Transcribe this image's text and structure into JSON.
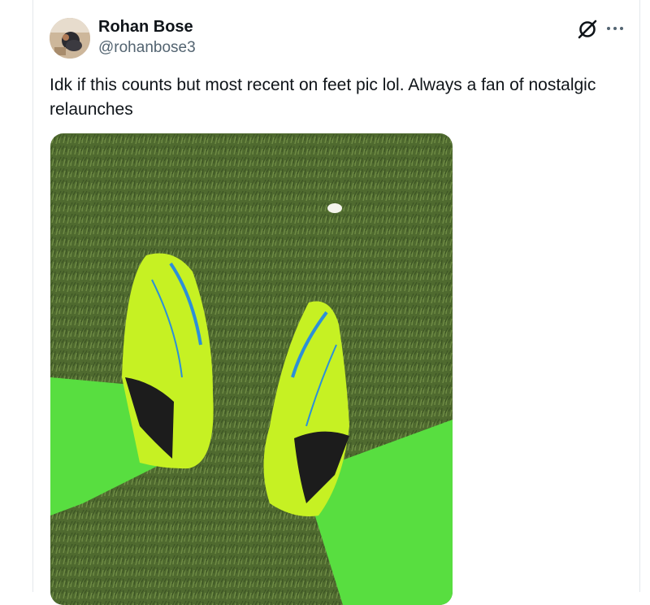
{
  "tweet": {
    "author": {
      "display_name": "Rohan Bose",
      "handle": "@rohanbose3",
      "avatar_icon": "profile-photo"
    },
    "text": "Idk if this counts but most recent on feet pic lol. Always a fan of nostalgic relaunches",
    "actions": {
      "grok_icon": "grok-icon",
      "more_icon": "more-options-icon"
    },
    "media": {
      "type": "photo",
      "subject": "neon yellow football boots and green socks on artificial turf"
    }
  },
  "colors": {
    "text_primary": "#0f1419",
    "text_secondary": "#536471",
    "border": "#e4e8ec",
    "turf": "#4f6a2f",
    "boot": "#c6f123",
    "sock": "#58de40"
  }
}
